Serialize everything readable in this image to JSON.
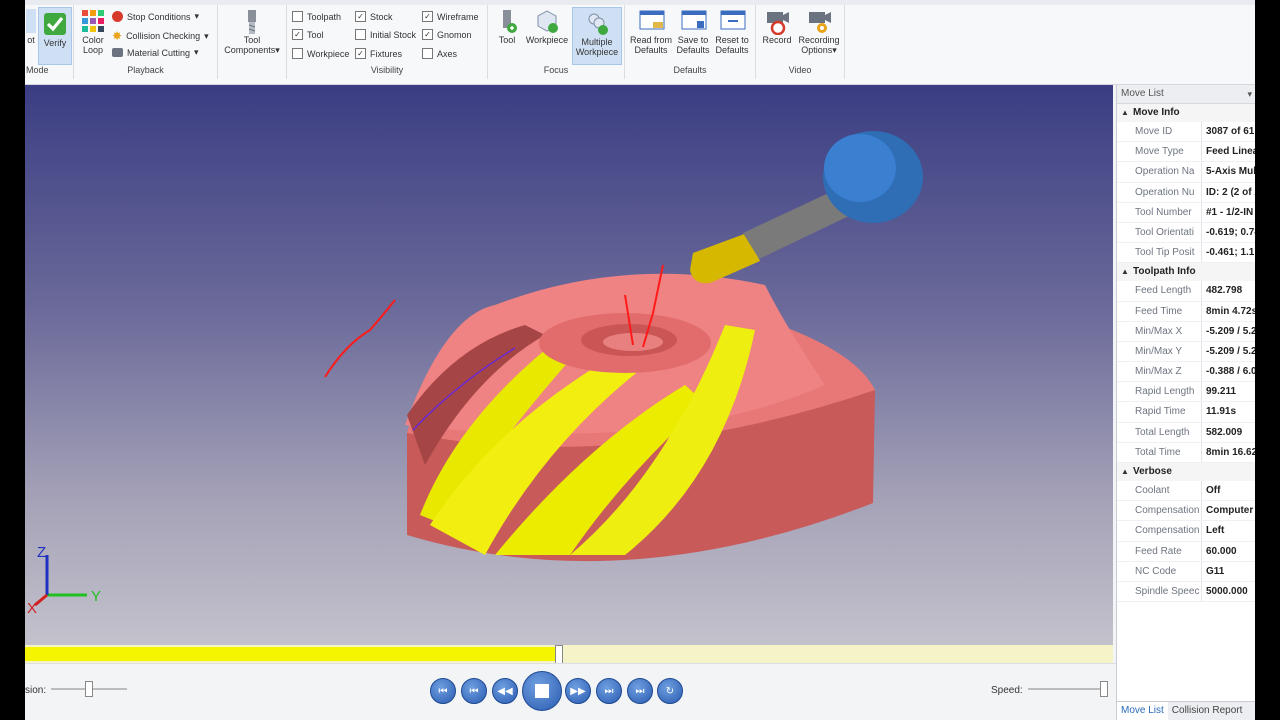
{
  "ribbon": {
    "mode": {
      "label": "Mode",
      "buttons": [
        {
          "label": "ot"
        },
        {
          "label": "Verify"
        }
      ]
    },
    "playback": {
      "label": "Playback",
      "color_loop": "Color Loop",
      "stop_conditions": "Stop Conditions",
      "collision_checking": "Collision Checking",
      "material_cutting": "Material Cutting"
    },
    "tool_components": "Tool Components",
    "visibility": {
      "label": "Visibility",
      "items": [
        {
          "label": "Toolpath",
          "checked": false
        },
        {
          "label": "Tool",
          "checked": true
        },
        {
          "label": "Workpiece",
          "checked": false
        },
        {
          "label": "Stock",
          "checked": true
        },
        {
          "label": "Initial Stock",
          "checked": false
        },
        {
          "label": "Fixtures",
          "checked": true
        },
        {
          "label": "Wireframe",
          "checked": true
        },
        {
          "label": "Gnomon",
          "checked": true
        },
        {
          "label": "Axes",
          "checked": false
        }
      ]
    },
    "focus": {
      "label": "Focus",
      "tool": "Tool",
      "workpiece": "Workpiece",
      "multiple": "Multiple Workpiece"
    },
    "defaults": {
      "label": "Defaults",
      "read": "Read from Defaults",
      "save": "Save to Defaults",
      "reset": "Reset to Defaults"
    },
    "video": {
      "label": "Video",
      "record": "Record",
      "options": "Recording Options"
    }
  },
  "viewport": {
    "axis_x": "X",
    "axis_y": "Y",
    "axis_z": "Z"
  },
  "bottom": {
    "precision_label": "sion:",
    "speed_label": "Speed:",
    "timeline_progress": 0.49
  },
  "panel": {
    "title": "Move List",
    "sections": {
      "move_info": {
        "title": "Move Info",
        "rows": [
          {
            "k": "Move ID",
            "v": "3087 of 61"
          },
          {
            "k": "Move Type",
            "v": "Feed Linear"
          },
          {
            "k": "Operation Na",
            "v": "5-Axis Mult"
          },
          {
            "k": "Operation Nu",
            "v": "ID: 2 (2 of 2"
          },
          {
            "k": "Tool Number",
            "v": "#1 - 1/2-IN"
          },
          {
            "k": "Tool Orientati",
            "v": "-0.619; 0.74"
          },
          {
            "k": "Tool Tip Posit",
            "v": "-0.461; 1.1"
          }
        ]
      },
      "toolpath_info": {
        "title": "Toolpath Info",
        "rows": [
          {
            "k": "Feed Length",
            "v": "482.798"
          },
          {
            "k": "Feed Time",
            "v": "8min 4.72s"
          },
          {
            "k": "Min/Max X",
            "v": "-5.209 / 5.2"
          },
          {
            "k": "Min/Max Y",
            "v": "-5.209 / 5.2"
          },
          {
            "k": "Min/Max Z",
            "v": "-0.388 / 6.0"
          },
          {
            "k": "Rapid Length",
            "v": "99.211"
          },
          {
            "k": "Rapid Time",
            "v": "11.91s"
          },
          {
            "k": "Total Length",
            "v": "582.009"
          },
          {
            "k": "Total Time",
            "v": "8min 16.62"
          }
        ]
      },
      "verbose": {
        "title": "Verbose",
        "rows": [
          {
            "k": "Coolant",
            "v": "Off"
          },
          {
            "k": "Compensation",
            "v": "Computer"
          },
          {
            "k": "Compensation",
            "v": "Left"
          },
          {
            "k": "Feed Rate",
            "v": "60.000"
          },
          {
            "k": "NC Code",
            "v": "G11"
          },
          {
            "k": "Spindle Speec",
            "v": "5000.000"
          }
        ]
      }
    },
    "tabs": [
      "Move List",
      "Collision Report"
    ]
  }
}
